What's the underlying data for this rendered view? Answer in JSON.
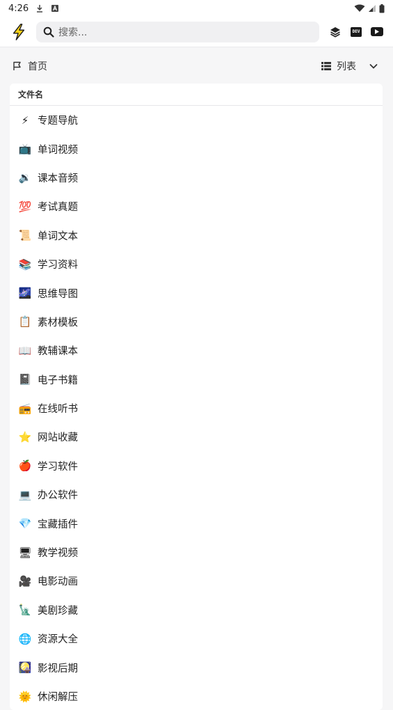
{
  "status_bar": {
    "time": "4:26"
  },
  "search": {
    "placeholder": "搜索..."
  },
  "breadcrumb": {
    "home": "首页"
  },
  "view": {
    "mode_label": "列表"
  },
  "table": {
    "column_header": "文件名",
    "rows": [
      {
        "icon": "⚡",
        "label": "专题导航"
      },
      {
        "icon": "📺",
        "label": "单词视频"
      },
      {
        "icon": "🔉",
        "label": "课本音频"
      },
      {
        "icon": "💯",
        "label": "考试真题"
      },
      {
        "icon": "📜",
        "label": "单词文本"
      },
      {
        "icon": "📚",
        "label": "学习资料"
      },
      {
        "icon": "🌌",
        "label": "思维导图"
      },
      {
        "icon": "📋",
        "label": "素材模板"
      },
      {
        "icon": "📖",
        "label": "教辅课本"
      },
      {
        "icon": "📓",
        "label": "电子书籍"
      },
      {
        "icon": "📻",
        "label": "在线听书"
      },
      {
        "icon": "⭐",
        "label": "网站收藏"
      },
      {
        "icon": "🍎",
        "label": "学习软件"
      },
      {
        "icon": "💻",
        "label": "办公软件"
      },
      {
        "icon": "💎",
        "label": "宝藏插件"
      },
      {
        "icon": "🖥",
        "label": "教学视频"
      },
      {
        "icon": "🎥",
        "label": "电影动画"
      },
      {
        "icon": "🗽",
        "label": "美剧珍藏"
      },
      {
        "icon": "🌐",
        "label": "资源大全"
      },
      {
        "icon": "🎑",
        "label": "影视后期"
      },
      {
        "icon": "🌞",
        "label": "休闲解压"
      }
    ]
  },
  "colors": {
    "accent": "#f5c518",
    "background": "#f6f6f7"
  }
}
